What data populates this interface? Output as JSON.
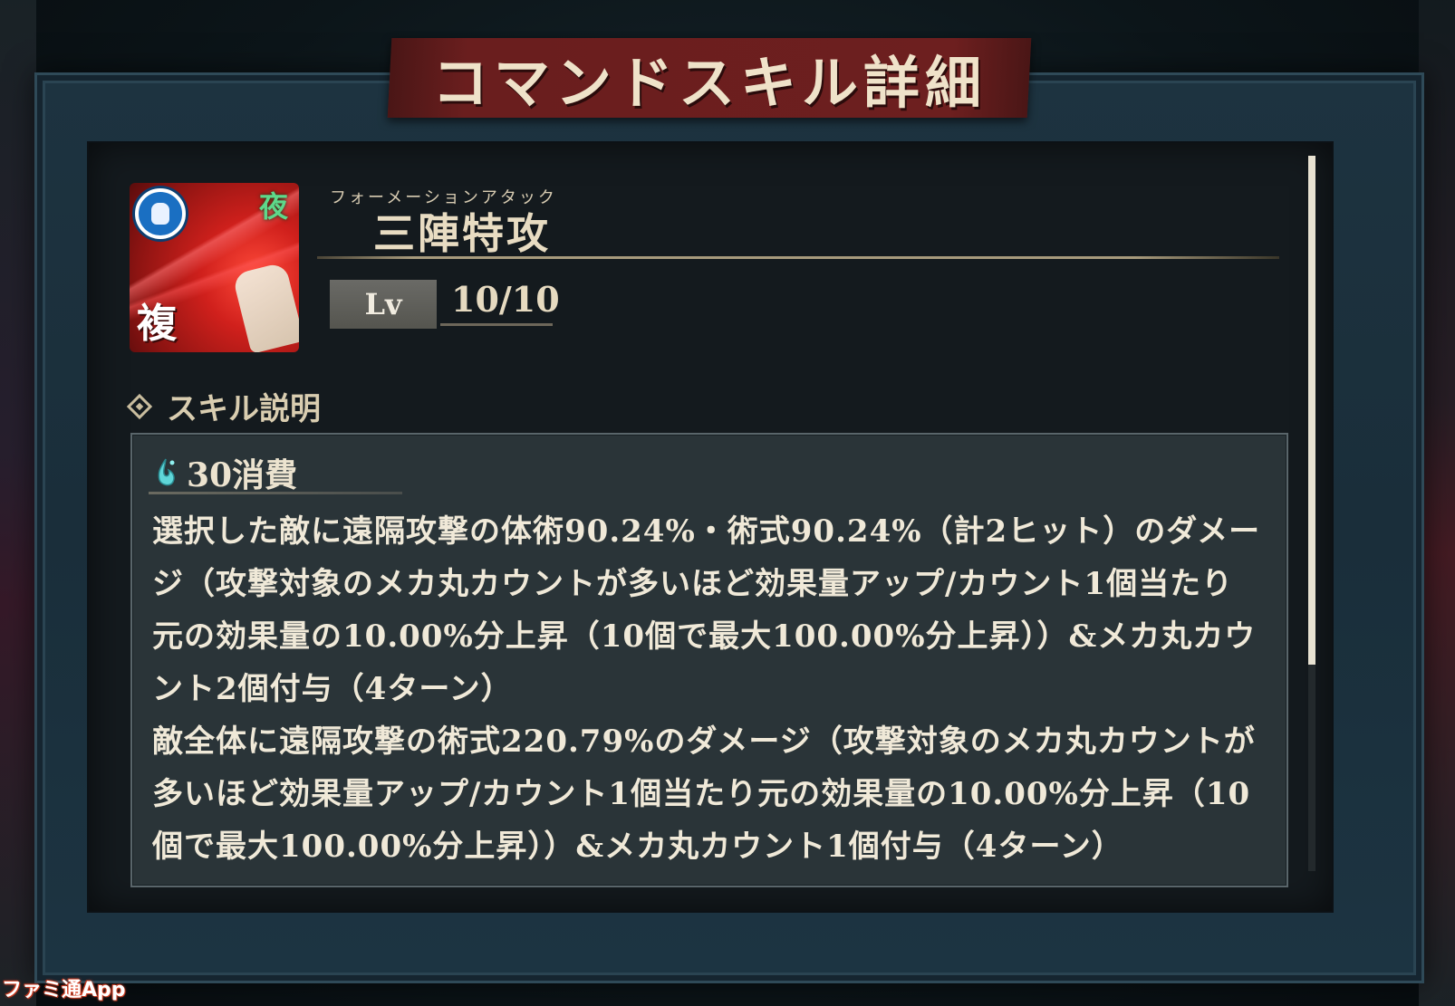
{
  "title": "コマンドスキル詳細",
  "skill": {
    "ruby": "フォーメーションアタック",
    "name": "三陣特攻",
    "icon_badge_night": "夜",
    "icon_badge_multi": "複",
    "level_label": "Lv",
    "level_value": "10/10"
  },
  "description": {
    "section_label": "スキル説明",
    "cost": "30消費",
    "paragraph_1": "選択した敵に遠隔攻撃の体術90.24%・術式90.24%（計2ヒット）のダメージ（攻撃対象のメカ丸カウントが多いほど効果量アップ/カウント1個当たり元の効果量の10.00%分上昇（10個で最大100.00%分上昇））&メカ丸カウント2個付与（4ターン）",
    "paragraph_2": "敵全体に遠隔攻撃の術式220.79%のダメージ（攻撃対象のメカ丸カウントが多いほど効果量アップ/カウント1個当たり元の効果量の10.00%分上昇（10個で最大100.00%分上昇））&メカ丸カウント1個付与（4ターン）"
  },
  "scroll_position": 0.0,
  "watermark": "ファミ通App",
  "colors": {
    "banner": "#6a1e1e",
    "frame": "#1d3340",
    "panel": "#2a3438",
    "text": "#f0e9d8",
    "accent_gold": "#d9cdb0"
  }
}
